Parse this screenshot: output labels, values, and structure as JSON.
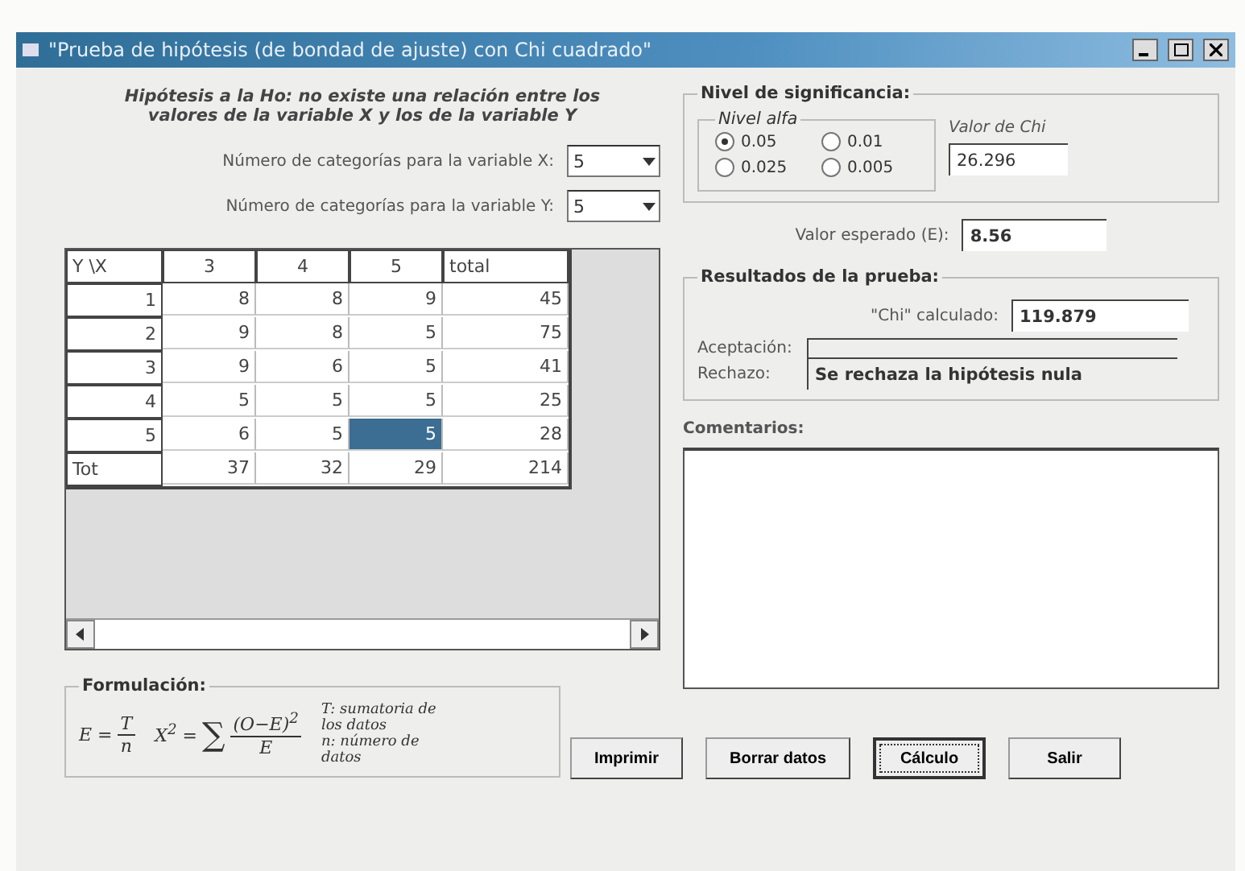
{
  "window": {
    "title": "\"Prueba de hipótesis (de bondad de ajuste) con Chi cuadrado\""
  },
  "hypothesis": "Hipótesis a la Ho: no existe una relación entre los valores de la variable X y los de la variable Y",
  "selectors": [
    {
      "label": "Número de categorías para la variable X:",
      "value": "5"
    },
    {
      "label": "Número de categorías para la variable Y:",
      "value": "5"
    }
  ],
  "grid": {
    "columns": [
      "Y \\X",
      "3",
      "4",
      "5",
      "total"
    ],
    "rows": [
      {
        "label": "1",
        "cells": [
          {
            "value": "8",
            "selected": false
          },
          {
            "value": "8",
            "selected": false
          },
          {
            "value": "9",
            "selected": false
          },
          {
            "value": "45",
            "selected": false
          }
        ]
      },
      {
        "label": "2",
        "cells": [
          {
            "value": "9",
            "selected": false
          },
          {
            "value": "8",
            "selected": false
          },
          {
            "value": "5",
            "selected": false
          },
          {
            "value": "75",
            "selected": false
          }
        ]
      },
      {
        "label": "3",
        "cells": [
          {
            "value": "9",
            "selected": false
          },
          {
            "value": "6",
            "selected": false
          },
          {
            "value": "5",
            "selected": false
          },
          {
            "value": "41",
            "selected": false
          }
        ]
      },
      {
        "label": "4",
        "cells": [
          {
            "value": "5",
            "selected": false
          },
          {
            "value": "5",
            "selected": false
          },
          {
            "value": "5",
            "selected": false
          },
          {
            "value": "25",
            "selected": false
          }
        ]
      },
      {
        "label": "5",
        "cells": [
          {
            "value": "6",
            "selected": false
          },
          {
            "value": "5",
            "selected": false
          },
          {
            "value": "5",
            "selected": true
          },
          {
            "value": "28",
            "selected": false
          }
        ]
      },
      {
        "label": "Tot",
        "cells": [
          {
            "value": "37",
            "selected": false
          },
          {
            "value": "32",
            "selected": false
          },
          {
            "value": "29",
            "selected": false
          },
          {
            "value": "214",
            "selected": false
          }
        ]
      }
    ]
  },
  "formula": {
    "title": "Formulación:",
    "expected": {
      "lhs": "E =",
      "num": "T",
      "den": "n"
    },
    "chi": {
      "lhs": "X$^{2}$ =",
      "sigma": "∑",
      "num": "(O−E)$^{2}$",
      "den": "E"
    },
    "notes": [
      "T: sumatoria de los datos",
      "n: número de datos"
    ]
  },
  "significance": {
    "title": "Nivel de significancia:",
    "group": "Nivel alfa",
    "options": [
      {
        "label": "0.05",
        "selected": true
      },
      {
        "label": "0.01",
        "selected": false
      },
      {
        "label": "0.025",
        "selected": false
      },
      {
        "label": "0.005",
        "selected": false
      }
    ],
    "critical_label": "Valor de Chi",
    "critical_value": "26.296"
  },
  "expected": {
    "label": "Valor esperado (E):",
    "value": "8.56"
  },
  "results": {
    "title": "Resultados de la prueba:",
    "chi_label": "\"Chi\" calculado:",
    "chi_value": "119.879",
    "accept_label": "Aceptación:",
    "reject_label": "Rechazo:",
    "reject_value": "Se rechaza la hipótesis nula"
  },
  "comments": {
    "label": "Comentarios:"
  },
  "buttons": [
    {
      "label": "Imprimir",
      "default": false
    },
    {
      "label": "Borrar datos",
      "default": false
    },
    {
      "label": "Cálculo",
      "default": true
    },
    {
      "label": "Salir",
      "default": false
    }
  ]
}
